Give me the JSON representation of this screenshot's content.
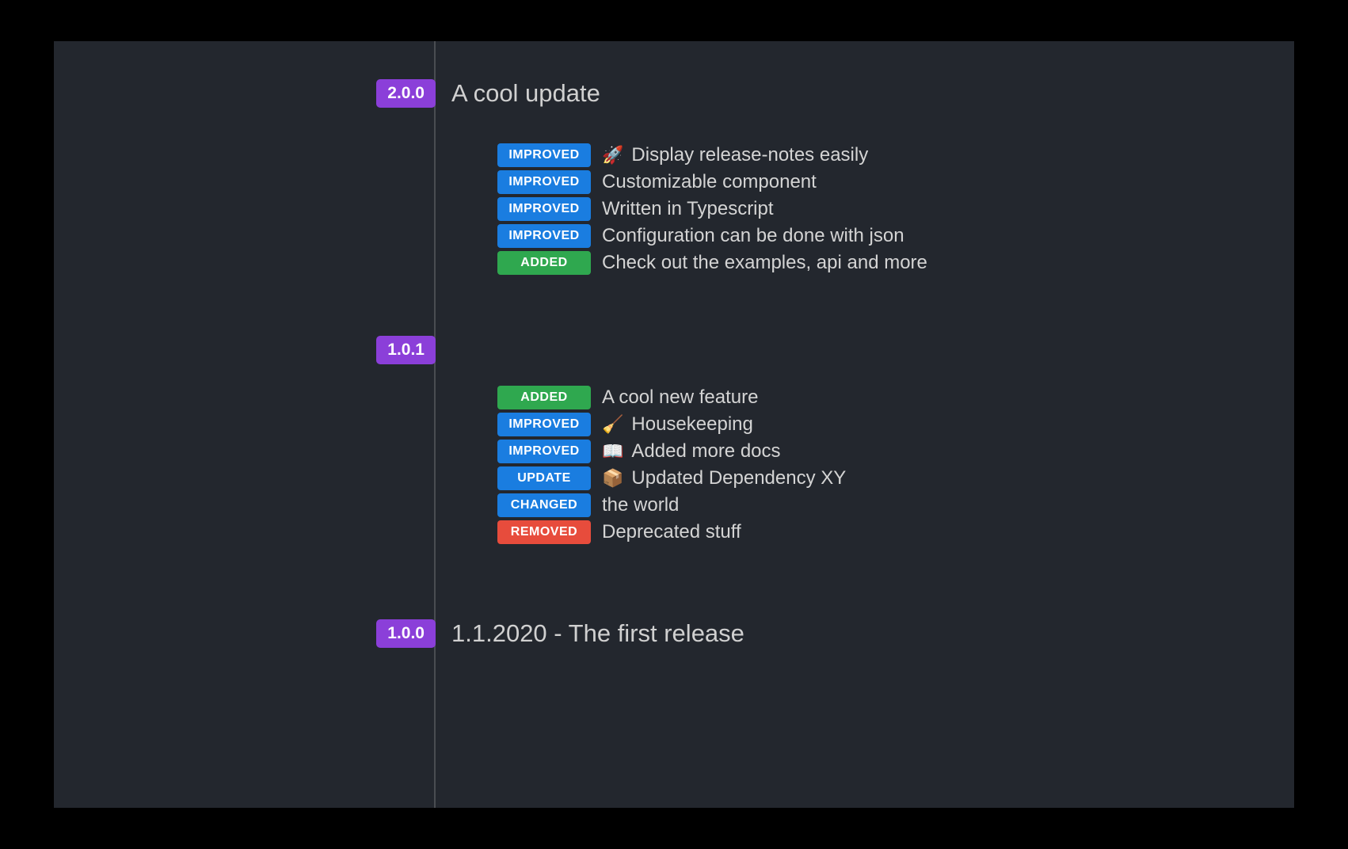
{
  "tags": {
    "improved": "IMPROVED",
    "added": "ADDED",
    "update": "UPDATE",
    "changed": "CHANGED",
    "removed": "REMOVED"
  },
  "releases": [
    {
      "version": "2.0.0",
      "title": "A cool update",
      "items": [
        {
          "tag": "improved",
          "emoji": "🚀",
          "text": "Display release-notes easily"
        },
        {
          "tag": "improved",
          "emoji": "",
          "text": "Customizable component"
        },
        {
          "tag": "improved",
          "emoji": "",
          "text": "Written in Typescript"
        },
        {
          "tag": "improved",
          "emoji": "",
          "text": "Configuration can be done with json"
        },
        {
          "tag": "added",
          "emoji": "",
          "text": "Check out the examples, api and more"
        }
      ]
    },
    {
      "version": "1.0.1",
      "title": "",
      "items": [
        {
          "tag": "added",
          "emoji": "",
          "text": "A cool new feature"
        },
        {
          "tag": "improved",
          "emoji": "🧹",
          "text": "Housekeeping"
        },
        {
          "tag": "improved",
          "emoji": "📖",
          "text": "Added more docs"
        },
        {
          "tag": "update",
          "emoji": "📦",
          "text": "Updated Dependency XY"
        },
        {
          "tag": "changed",
          "emoji": "",
          "text": "the world"
        },
        {
          "tag": "removed",
          "emoji": "",
          "text": "Deprecated stuff"
        }
      ]
    },
    {
      "version": "1.0.0",
      "title": "1.1.2020 - The first release",
      "items": []
    }
  ]
}
